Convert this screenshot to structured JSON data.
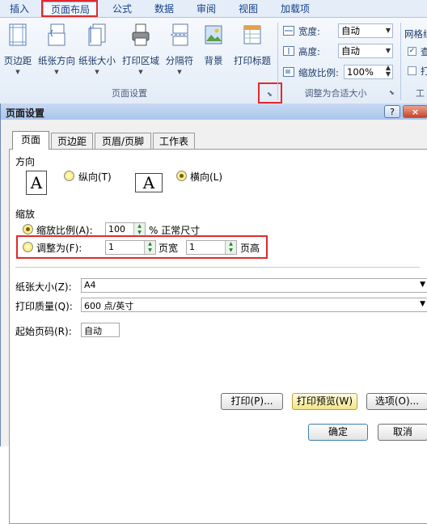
{
  "ribbon": {
    "tabs": [
      {
        "label": "插入"
      },
      {
        "label": "页面布局",
        "active": true
      },
      {
        "label": "公式"
      },
      {
        "label": "数据"
      },
      {
        "label": "审阅"
      },
      {
        "label": "视图"
      },
      {
        "label": "加载项"
      }
    ],
    "buttons": [
      {
        "label": "页边距",
        "icon": "margins-icon"
      },
      {
        "label": "纸张方向",
        "icon": "orientation-icon"
      },
      {
        "label": "纸张大小",
        "icon": "paper-size-icon"
      },
      {
        "label": "打印区域",
        "icon": "print-area-icon"
      },
      {
        "label": "分隔符",
        "icon": "breaks-icon"
      },
      {
        "label": "背景",
        "icon": "background-icon"
      },
      {
        "label": "打印标题",
        "icon": "print-titles-icon"
      }
    ],
    "page_setup_group": "页面设置",
    "scale_group": {
      "label": "调整为合适大小",
      "width_label": "宽度:",
      "width_value": "自动",
      "height_label": "高度:",
      "height_value": "自动",
      "scale_label": "缩放比例:",
      "scale_value": "100%"
    },
    "sheet_options": {
      "label_partial": "网格线",
      "view_partial": "查",
      "print_partial": "打",
      "group_partial": "工"
    }
  },
  "dialog": {
    "title": "页面设置",
    "help": "?",
    "close": "×",
    "tabs": [
      "页面",
      "页边距",
      "页眉/页脚",
      "工作表"
    ],
    "orientation": {
      "heading": "方向",
      "portrait": "纵向(T)",
      "landscape": "横向(L)",
      "glyph": "A",
      "selected": "landscape"
    },
    "scaling": {
      "heading": "缩放",
      "adjust_to_label": "缩放比例(A):",
      "adjust_to_value": "100",
      "adjust_suffix": "% 正常尺寸",
      "fit_to_label": "调整为(F):",
      "fit_wide_value": "1",
      "fit_wide_label": "页宽",
      "fit_tall_value": "1",
      "fit_tall_label": "页高"
    },
    "paper_size": {
      "label": "纸张大小(Z):",
      "value": "A4"
    },
    "print_quality": {
      "label": "打印质量(Q):",
      "value": "600 点/英寸"
    },
    "first_page": {
      "label": "起始页码(R):",
      "value": "自动"
    },
    "buttons": {
      "print": "打印(P)...",
      "preview": "打印预览(W)",
      "options": "选项(O)...",
      "ok": "确定",
      "cancel": "取消"
    }
  },
  "colors": {
    "highlight_box": "#e02a2a",
    "ribbon_text": "#15428b"
  }
}
